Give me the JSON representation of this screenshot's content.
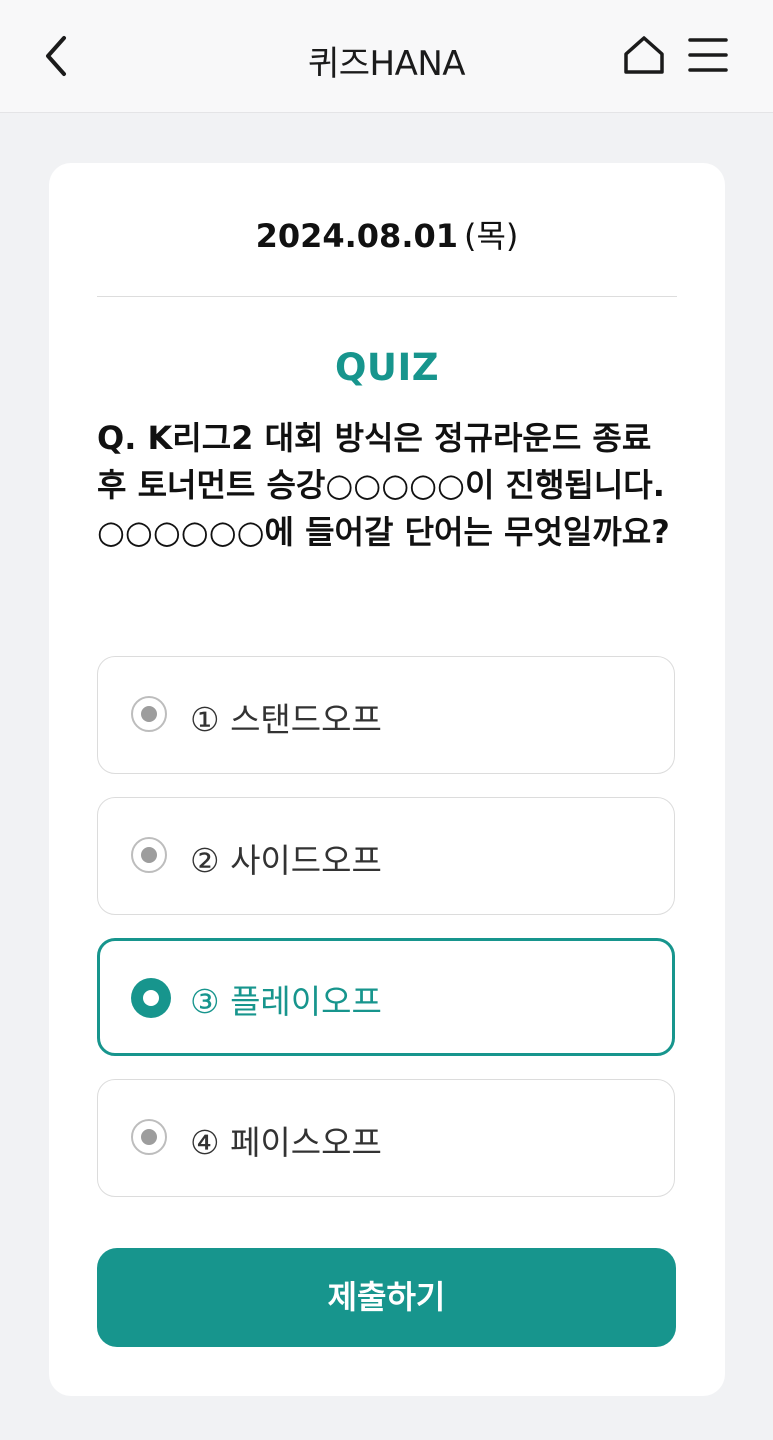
{
  "header": {
    "title": "퀴즈HANA",
    "back_icon": "chevron-left-icon",
    "home_icon": "home-icon",
    "menu_icon": "hamburger-menu-icon"
  },
  "quiz": {
    "date": "2024.08.01",
    "day_of_week": "(목)",
    "label": "QUIZ",
    "question": "Q. K리그2 대회 방식은 정규라운드 종료 후 토너먼트 승강○○○○○이 진행됩니다. ○○○○○○에 들어갈 단어는 무엇일까요?",
    "options": [
      {
        "label": "① 스탠드오프",
        "selected": false
      },
      {
        "label": "② 사이드오프",
        "selected": false
      },
      {
        "label": "③ 플레이오프",
        "selected": true
      },
      {
        "label": "④ 페이스오프",
        "selected": false
      }
    ],
    "submit_label": "제출하기"
  },
  "colors": {
    "accent": "#17958d",
    "background": "#f1f2f4",
    "card": "#ffffff"
  }
}
